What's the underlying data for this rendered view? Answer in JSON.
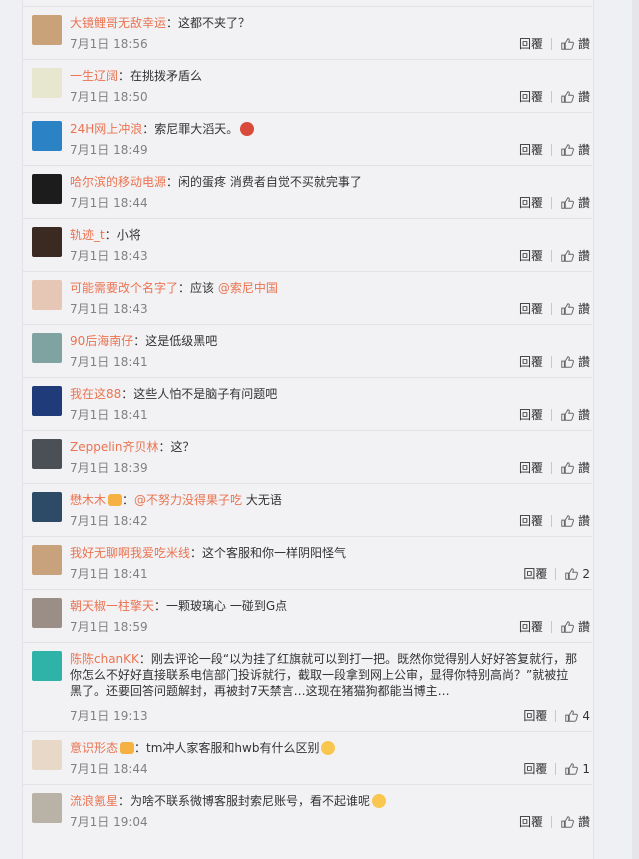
{
  "comments": [
    {
      "name": "大镜鲤哥无敌幸运",
      "text": "：这都不夹了？",
      "time": "7月1日 18:56",
      "reply": "回覆",
      "likes": "讚",
      "avatar_color": "#c9a27a"
    },
    {
      "name": "一生辽阔",
      "text": "：在挑拨矛盾么",
      "time": "7月1日 18:50",
      "reply": "回覆",
      "likes": "讚",
      "avatar_color": "#e7e6cf"
    },
    {
      "name": "24H网上冲浪",
      "text": "：索尼罪大滔天。",
      "time": "7月1日 18:49",
      "reply": "回覆",
      "likes": "讚",
      "avatar_color": "#2b83c6",
      "emoji": "red"
    },
    {
      "name": "哈尔滨的移动电源",
      "text": "：闲的蛋疼 消费者自觉不买就完事了",
      "time": "7月1日 18:44",
      "reply": "回覆",
      "likes": "讚",
      "avatar_color": "#1c1c1c"
    },
    {
      "name": "轨迹_t",
      "text": "：小将",
      "time": "7月1日 18:43",
      "reply": "回覆",
      "likes": "讚",
      "avatar_color": "#3a2a22"
    },
    {
      "name": "可能需要改个名字了",
      "text": "：应该 ",
      "mention": "@索尼中国",
      "time": "7月1日 18:43",
      "reply": "回覆",
      "likes": "讚",
      "avatar_color": "#e6c7b5"
    },
    {
      "name": "90后海南仔",
      "text": "：这是低级黑吧",
      "time": "7月1日 18:41",
      "reply": "回覆",
      "likes": "讚",
      "avatar_color": "#7fa3a0"
    },
    {
      "name": "我在这88",
      "text": "：这些人怕不是脑子有问题吧",
      "time": "7月1日 18:41",
      "reply": "回覆",
      "likes": "讚",
      "avatar_color": "#1f3b7a"
    },
    {
      "name": "Zeppelin齐贝林",
      "text": "：这？",
      "time": "7月1日 18:39",
      "reply": "回覆",
      "likes": "讚",
      "avatar_color": "#4b4f56"
    },
    {
      "name": "懋木木",
      "badge": true,
      "text": "：",
      "mention": "@不努力没得果子吃",
      "text2": " 大无语",
      "time": "7月1日 18:42",
      "reply": "回覆",
      "likes": "讚",
      "avatar_color": "#2d4a66"
    },
    {
      "name": "我好无聊啊我爱吃米线",
      "text": "：这个客服和你一样阴阳怪气",
      "time": "7月1日 18:41",
      "reply": "回覆",
      "likes": "2",
      "avatar_color": "#c8a27d"
    },
    {
      "name": "朝天椒一柱擎天",
      "text": "：一颗玻璃心 一碰到G点",
      "time": "7月1日 18:59",
      "reply": "回覆",
      "likes": "讚",
      "avatar_color": "#9b8e86"
    },
    {
      "name": "陈陈chanKK",
      "text": "：刚去评论一段“以为挂了红旗就可以到打一把。既然你觉得别人好好答复就行，那你怎么不好好直接联系电信部门投诉就行，截取一段拿到网上公审，显得你特别高尚？”就被拉黑了。还要回答问题解封，再被封7天禁言…这现在猪猫狗都能当博主…",
      "time": "7月1日 19:13",
      "reply": "回覆",
      "likes": "4",
      "avatar_color": "#2fb3a9",
      "tall": true
    },
    {
      "name": "意识形态",
      "badge": true,
      "text": "：tm冲人家客服和hwb有什么区别",
      "time": "7月1日 18:44",
      "reply": "回覆",
      "likes": "1",
      "avatar_color": "#e8d8c8",
      "emoji": "yellow"
    },
    {
      "name": "流浪氪星",
      "text": "：为啥不联系微博客服封索尼账号，看不起谁呢",
      "time": "7月1日 19:04",
      "reply": "回覆",
      "likes": "讚",
      "avatar_color": "#b9b2a6",
      "emoji": "yellow"
    }
  ]
}
